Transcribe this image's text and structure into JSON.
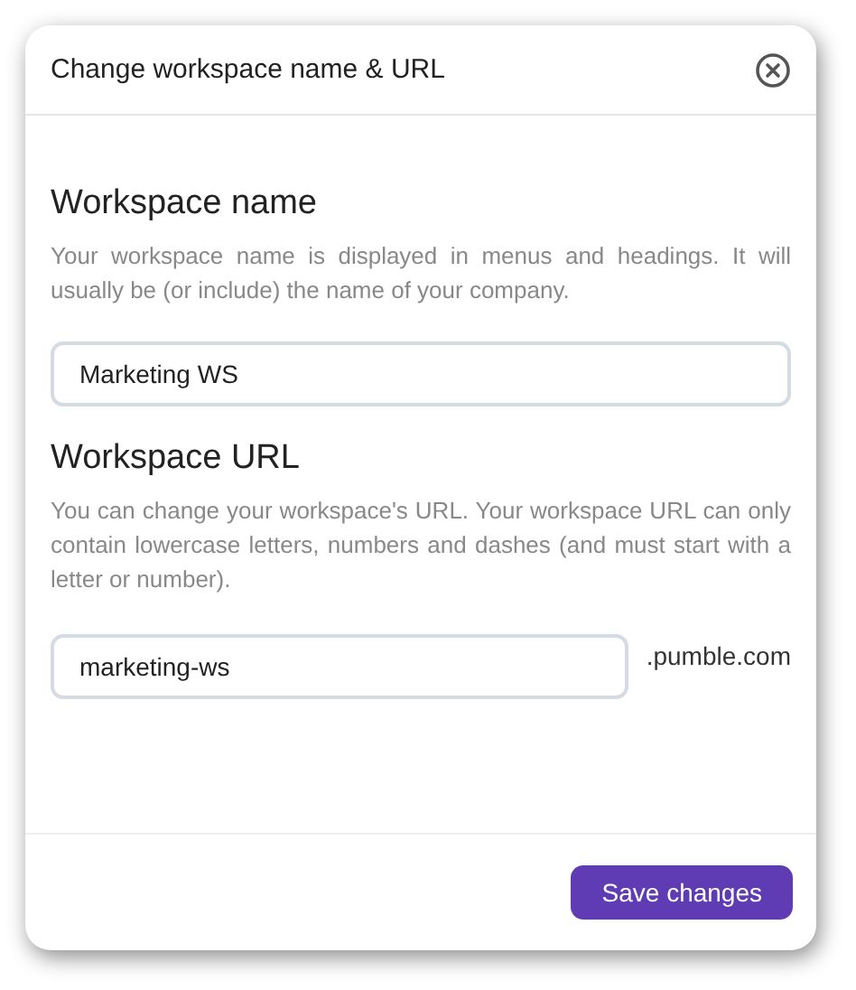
{
  "dialog": {
    "title": "Change workspace name & URL"
  },
  "sections": [
    {
      "kind": "name",
      "heading": "Workspace name",
      "description": "Your workspace name is displayed in menus and headings. It will usually be (or include) the name of your company.",
      "value": "Marketing WS"
    },
    {
      "kind": "url",
      "heading": "Workspace URL",
      "description": "You can change your workspace's URL. Your workspace URL can only contain lowercase letters, numbers and dashes (and must start with a letter or number).",
      "value": "marketing-ws",
      "suffix": ".pumble.com"
    }
  ],
  "buttons": [
    "Save changes"
  ]
}
